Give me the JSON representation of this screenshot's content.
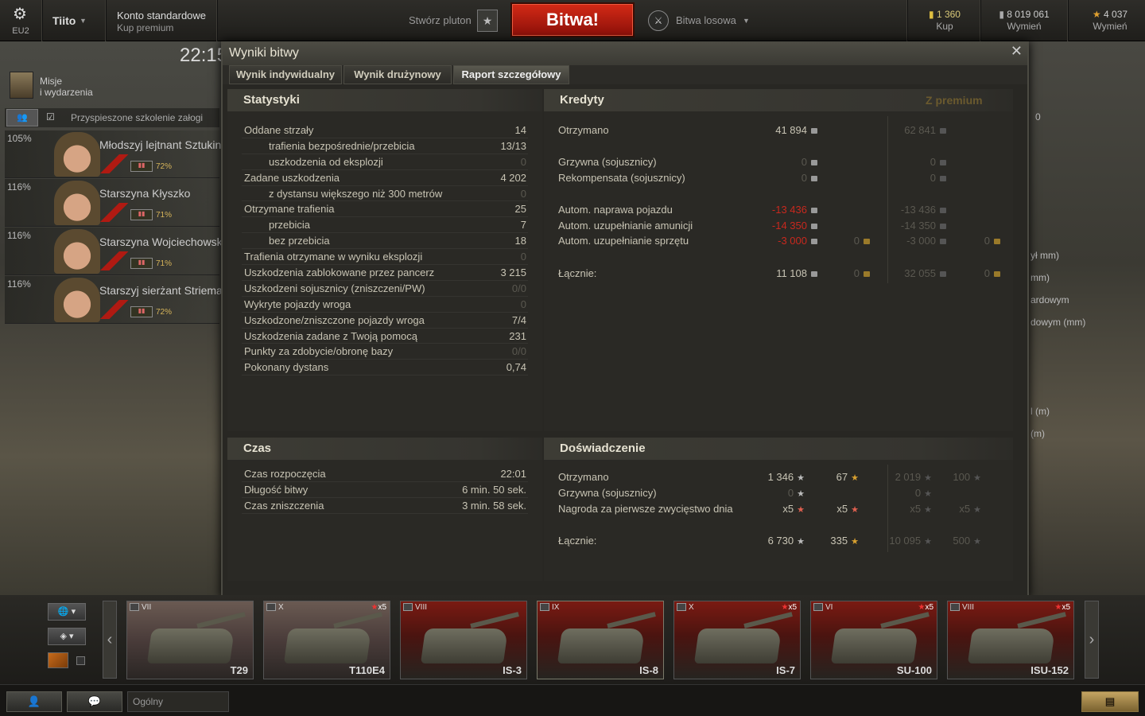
{
  "topbar": {
    "server": "EU2",
    "player": "Tiito",
    "account_type": "Konto standardowe",
    "account_sub": "Kup premium",
    "platoon": "Stwórz pluton",
    "battle_button": "Bitwa!",
    "battle_mode": "Bitwa losowa",
    "currencies": [
      {
        "value": "1 360",
        "label": "Kup",
        "icon": "gold-icon"
      },
      {
        "value": "8 019 061",
        "label": "Wymień",
        "icon": "credits-icon"
      },
      {
        "value": "4 037",
        "label": "Wymień",
        "icon": "free-xp-icon"
      }
    ]
  },
  "left": {
    "clock": "22:15",
    "missions_l1": "Misje",
    "missions_l2": "i wydarzenia",
    "accelerated_training": "Przyspieszone szkolenie załogi",
    "crew": [
      {
        "pct": "105%",
        "name": "Młodszyj lejtnant Sztukin",
        "skill": "72%"
      },
      {
        "pct": "116%",
        "name": "Starszyna Kłyszko",
        "skill": "71%"
      },
      {
        "pct": "116%",
        "name": "Starszyna Wojciechowski",
        "skill": "71%"
      },
      {
        "pct": "116%",
        "name": "Starszyj sierżant Striemajło",
        "skill": "72%"
      }
    ]
  },
  "dialog": {
    "title": "Wyniki bitwy",
    "tabs": [
      "Wynik indywidualny",
      "Wynik drużynowy",
      "Raport szczegółowy"
    ],
    "stats": {
      "title": "Statystyki",
      "rows": [
        {
          "label": "Oddane strzały",
          "value": "14",
          "sub": false,
          "dim": false
        },
        {
          "label": "trafienia bezpośrednie/przebicia",
          "value": "13/13",
          "sub": true,
          "dim": false
        },
        {
          "label": "uszkodzenia od eksplozji",
          "value": "0",
          "sub": true,
          "dim": true
        },
        {
          "label": "Zadane uszkodzenia",
          "value": "4 202",
          "sub": false,
          "dim": false
        },
        {
          "label": "z dystansu większego niż 300 metrów",
          "value": "0",
          "sub": true,
          "dim": true
        },
        {
          "label": "Otrzymane trafienia",
          "value": "25",
          "sub": false,
          "dim": false
        },
        {
          "label": "przebicia",
          "value": "7",
          "sub": true,
          "dim": false
        },
        {
          "label": "bez przebicia",
          "value": "18",
          "sub": true,
          "dim": false
        },
        {
          "label": "Trafienia otrzymane w wyniku eksplozji",
          "value": "0",
          "sub": false,
          "dim": true
        },
        {
          "label": "Uszkodzenia zablokowane przez pancerz",
          "value": "3 215",
          "sub": false,
          "dim": false
        },
        {
          "label": "Uszkodzeni sojusznicy (zniszczeni/PW)",
          "value": "0/0",
          "sub": false,
          "dim": true
        },
        {
          "label": "Wykryte pojazdy wroga",
          "value": "0",
          "sub": false,
          "dim": true
        },
        {
          "label": "Uszkodzone/zniszczone pojazdy wroga",
          "value": "7/4",
          "sub": false,
          "dim": false
        },
        {
          "label": "Uszkodzenia zadane z Twoją pomocą",
          "value": "231",
          "sub": false,
          "dim": false
        },
        {
          "label": "Punkty za zdobycie/obronę bazy",
          "value": "0/0",
          "sub": false,
          "dim": true
        },
        {
          "label": "Pokonany dystans",
          "value": "0,74",
          "sub": false,
          "dim": false
        }
      ]
    },
    "time": {
      "title": "Czas",
      "rows": [
        {
          "label": "Czas rozpoczęcia",
          "value": "22:01"
        },
        {
          "label": "Długość bitwy",
          "value": "6 min. 50 sek."
        },
        {
          "label": "Czas zniszczenia",
          "value": "3 min. 58 sek."
        }
      ]
    },
    "credits": {
      "title": "Kredyty",
      "premium_title": "Z premium",
      "rows": [
        {
          "label": "Otrzymano",
          "c": "41 894",
          "cred": false,
          "cdim": false,
          "g": "",
          "pc": "62 841",
          "pg": ""
        },
        {
          "label": "Grzywna (sojusznicy)",
          "c": "0",
          "cred": false,
          "cdim": true,
          "g": "",
          "pc": "0",
          "pg": ""
        },
        {
          "label": "Rekompensata (sojusznicy)",
          "c": "0",
          "cred": false,
          "cdim": true,
          "g": "",
          "pc": "0",
          "pg": ""
        },
        {
          "label": "Autom. naprawa pojazdu",
          "c": "-13 436",
          "cred": true,
          "cdim": false,
          "g": "",
          "pc": "-13 436",
          "pg": ""
        },
        {
          "label": "Autom. uzupełnianie amunicji",
          "c": "-14 350",
          "cred": true,
          "cdim": false,
          "g": "",
          "pc": "-14 350",
          "pg": ""
        },
        {
          "label": "Autom. uzupełnianie sprzętu",
          "c": "-3 000",
          "cred": true,
          "cdim": false,
          "g": "0",
          "pc": "-3 000",
          "pg": "0"
        },
        {
          "label": "Łącznie:",
          "c": "11 108",
          "cred": false,
          "cdim": false,
          "g": "0",
          "pc": "32 055",
          "pg": "0"
        }
      ]
    },
    "xp": {
      "title": "Doświadczenie",
      "rows": [
        {
          "label": "Otrzymano",
          "x": "1 346",
          "fx": "67",
          "px": "2 019",
          "pfx": "100",
          "xdim": false,
          "fxstar": "gold"
        },
        {
          "label": "Grzywna (sojusznicy)",
          "x": "0",
          "fx": "",
          "px": "0",
          "pfx": "",
          "xdim": true,
          "fxstar": ""
        },
        {
          "label": "Nagroda za pierwsze zwycięstwo dnia",
          "x": "x5",
          "fx": "x5",
          "px": "x5",
          "pfx": "x5",
          "xdim": false,
          "fxstar": "red"
        },
        {
          "label": "Łącznie:",
          "x": "6 730",
          "fx": "335",
          "px": "10 095",
          "pfx": "500",
          "xdim": false,
          "fxstar": "gold"
        }
      ]
    }
  },
  "right_panel": {
    "rows": [
      "0",
      "ył mm)",
      "mm)",
      "ardowym",
      "dowym (mm)",
      "l (m)",
      "(m)"
    ]
  },
  "carousel": {
    "tanks": [
      {
        "name": "T29",
        "tier": "VII",
        "nation": "usa",
        "mult": ""
      },
      {
        "name": "T110E4",
        "tier": "X",
        "nation": "usa",
        "mult": "x5"
      },
      {
        "name": "IS-3",
        "tier": "VIII",
        "nation": "soviet",
        "mult": ""
      },
      {
        "name": "IS-8",
        "tier": "IX",
        "nation": "soviet",
        "mult": ""
      },
      {
        "name": "IS-7",
        "tier": "X",
        "nation": "soviet",
        "mult": "x5"
      },
      {
        "name": "SU-100",
        "tier": "VI",
        "nation": "soviet",
        "mult": "x5"
      },
      {
        "name": "ISU-152",
        "tier": "VIII",
        "nation": "soviet",
        "mult": "x5"
      }
    ]
  },
  "bottombar": {
    "channel": "Ogólny"
  },
  "colors": {
    "accent_red": "#c8281e",
    "gold": "#d8c878",
    "premium_title": "#6b5a2e"
  }
}
